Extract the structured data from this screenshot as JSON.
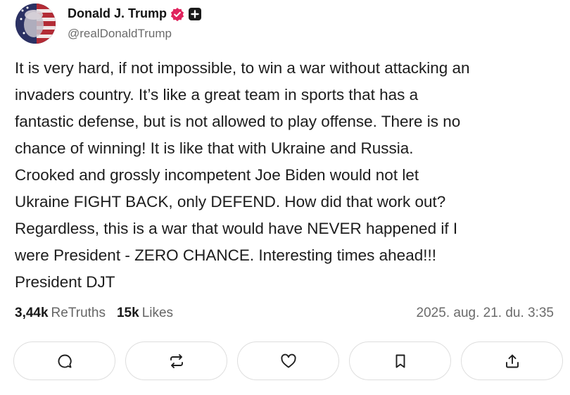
{
  "author": {
    "display_name": "Donald J. Trump",
    "handle": "@realDonaldTrump",
    "verified_color": "#e0245e",
    "avatar_icon": "flag-portrait-avatar"
  },
  "post": {
    "lines": [
      "It is very hard, if not impossible, to win a war without attacking an",
      "invaders country. It’s like a great team in sports that has a",
      "fantastic defense, but is not allowed to play offense. There is no",
      "chance of winning! It is like that with Ukraine and Russia.",
      "Crooked and grossly incompetent Joe Biden would not let",
      "Ukraine FIGHT BACK, only DEFEND. How did that work out?",
      "Regardless, this is a war that would have NEVER happened if I",
      "were President - ZERO CHANCE. Interesting times ahead!!!",
      "President DJT"
    ]
  },
  "stats": {
    "retruths_count": "3,44k",
    "retruths_label": "ReTruths",
    "likes_count": "15k",
    "likes_label": "Likes",
    "timestamp": "2025. aug. 21. du. 3:35"
  },
  "actions": [
    {
      "icon": "reply-icon"
    },
    {
      "icon": "retruth-icon"
    },
    {
      "icon": "heart-icon"
    },
    {
      "icon": "bookmark-icon"
    },
    {
      "icon": "share-icon"
    }
  ]
}
